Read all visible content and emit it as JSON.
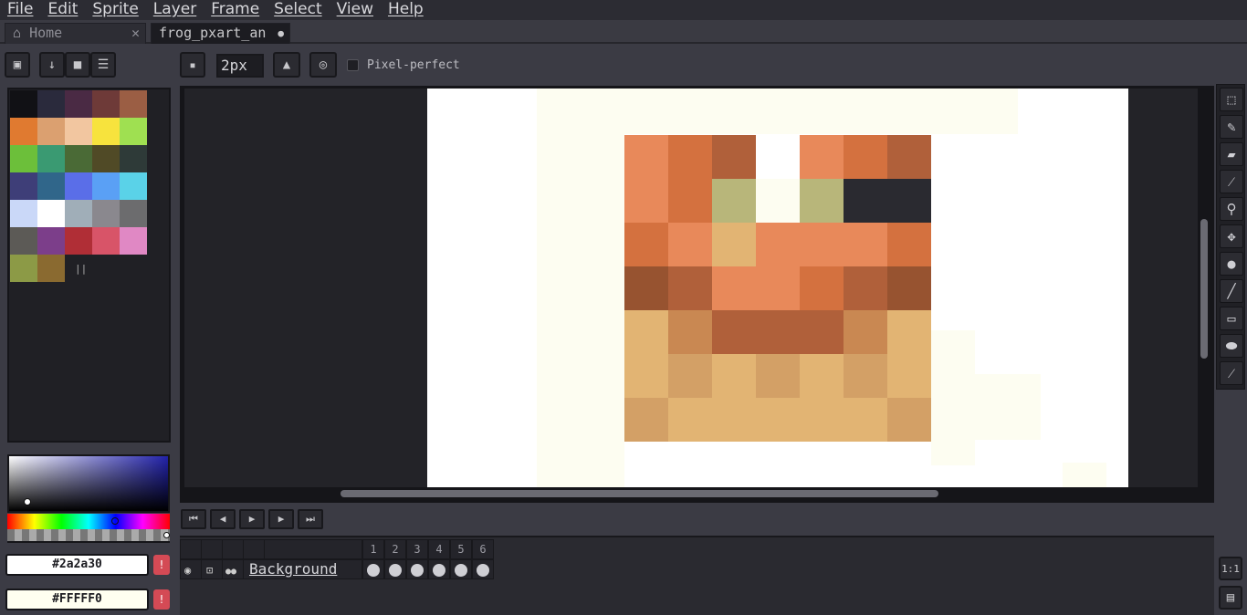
{
  "menu": [
    "File",
    "Edit",
    "Sprite",
    "Layer",
    "Frame",
    "Select",
    "View",
    "Help"
  ],
  "tabs": [
    {
      "label": "Home",
      "close": "✕"
    },
    {
      "label": "frog_pxart_an",
      "modified": "●"
    }
  ],
  "toolbar": {
    "brush_size": "2px",
    "pixel_perfect_label": "Pixel-perfect"
  },
  "palette": {
    "colors": [
      "#111115",
      "#2a2a3c",
      "#4a2a44",
      "#6e3a38",
      "#9b5e44",
      "#e07a30",
      "#dba070",
      "#f2c6a0",
      "#f7e33d",
      "#9fe051",
      "#6cbf3a",
      "#3a9a72",
      "#4a6a36",
      "#504a26",
      "#2e3a38",
      "#3e3e78",
      "#30668a",
      "#5a6ee8",
      "#5aa0f5",
      "#5ad2e8",
      "#cad8f8",
      "#ffffff",
      "#a0aeb8",
      "#8a888e",
      "#6c6c6e",
      "#5c5a56",
      "#7c3e8a",
      "#b02e36",
      "#d85468",
      "#e088c4",
      "#8c9a46",
      "#8a6a30"
    ],
    "divider_glyph": "||"
  },
  "color_fields": {
    "foreground_hex": "#2a2a30",
    "background_hex": "#FFFFF0",
    "warn_glyph": "!"
  },
  "right_tools": [
    "marquee-tool",
    "pencil-tool",
    "eraser-tool",
    "eyedropper-tool",
    "zoom-tool",
    "move-tool",
    "fill-tool",
    "line-tool",
    "rectangle-tool",
    "blob-tool",
    "blur-tool"
  ],
  "timeline": {
    "frames": [
      "1",
      "2",
      "3",
      "4",
      "5",
      "6"
    ],
    "layer_name": "Background",
    "zoom_label": "1:1"
  },
  "colors": {
    "accent": "#d44a55",
    "canvas_bg": "#232328"
  }
}
